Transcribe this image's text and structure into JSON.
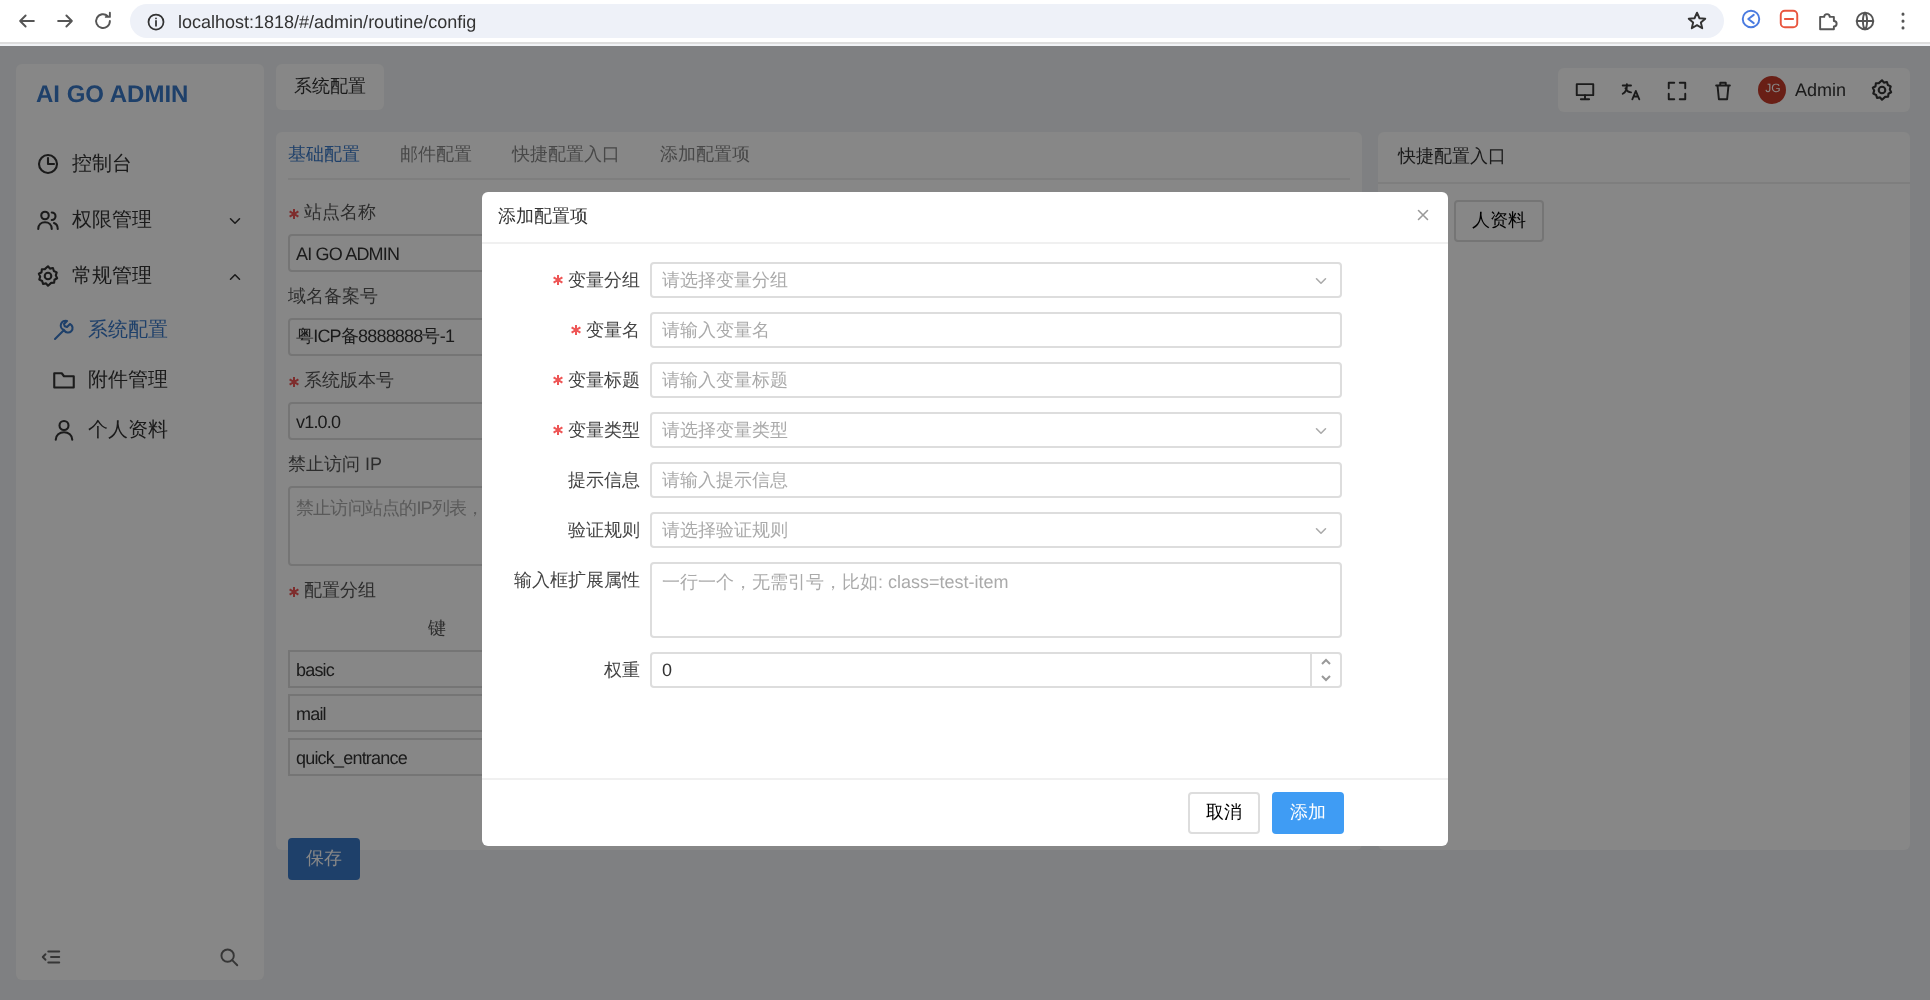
{
  "browser": {
    "url": "localhost:1818/#/admin/routine/config"
  },
  "sidebar": {
    "logo": "AI GO ADMIN",
    "items": [
      {
        "label": "控制台",
        "selected": false
      },
      {
        "label": "权限管理",
        "expanded": false,
        "selected": false
      },
      {
        "label": "常规管理",
        "expanded": true,
        "selected": false,
        "children": [
          {
            "label": "系统配置",
            "selected": true
          },
          {
            "label": "附件管理",
            "selected": false
          },
          {
            "label": "个人资料",
            "selected": false
          }
        ]
      }
    ]
  },
  "header": {
    "page_tab": "系统配置",
    "user": {
      "initials": "JG",
      "name": "Admin"
    }
  },
  "config_card": {
    "tabs": [
      {
        "label": "基础配置",
        "selected": true
      },
      {
        "label": "邮件配置",
        "selected": false
      },
      {
        "label": "快捷配置入口",
        "selected": false
      },
      {
        "label": "添加配置项",
        "selected": false
      }
    ],
    "fields": [
      {
        "label": "站点名称",
        "required": true,
        "kind": "input",
        "value": "AI GO ADMIN"
      },
      {
        "label": "域名备案号",
        "required": false,
        "kind": "input",
        "value": "粤ICP备8888888号-1"
      },
      {
        "label": "系统版本号",
        "required": true,
        "kind": "input",
        "value": "v1.0.0"
      },
      {
        "label": "禁止访问 IP",
        "required": false,
        "kind": "textarea",
        "placeholder": "禁止访问站点的IP列表，"
      },
      {
        "label": "配置分组",
        "required": true,
        "kind": "table",
        "column_1": "键",
        "rows": [
          "basic",
          "mail",
          "quick_entrance"
        ]
      }
    ],
    "save_button": "保存"
  },
  "quick_card": {
    "title": "快捷配置入口",
    "button": "人资料"
  },
  "dialog": {
    "title": "添加配置项",
    "fields": [
      {
        "label": "变量分组",
        "required": true,
        "kind": "select",
        "placeholder": "请选择变量分组"
      },
      {
        "label": "变量名",
        "required": true,
        "kind": "input",
        "placeholder": "请输入变量名"
      },
      {
        "label": "变量标题",
        "required": true,
        "kind": "input",
        "placeholder": "请输入变量标题"
      },
      {
        "label": "变量类型",
        "required": true,
        "kind": "select",
        "placeholder": "请选择变量类型"
      },
      {
        "label": "提示信息",
        "required": false,
        "kind": "input",
        "placeholder": "请输入提示信息"
      },
      {
        "label": "验证规则",
        "required": false,
        "kind": "select",
        "placeholder": "请选择验证规则"
      },
      {
        "label": "输入框扩展属性",
        "required": false,
        "kind": "textarea",
        "placeholder": "一行一个，无需引号，比如: class=test-item"
      },
      {
        "label": "权重",
        "required": false,
        "kind": "number",
        "value": "0"
      }
    ],
    "cancel_button": "取消",
    "submit_button": "添加"
  }
}
